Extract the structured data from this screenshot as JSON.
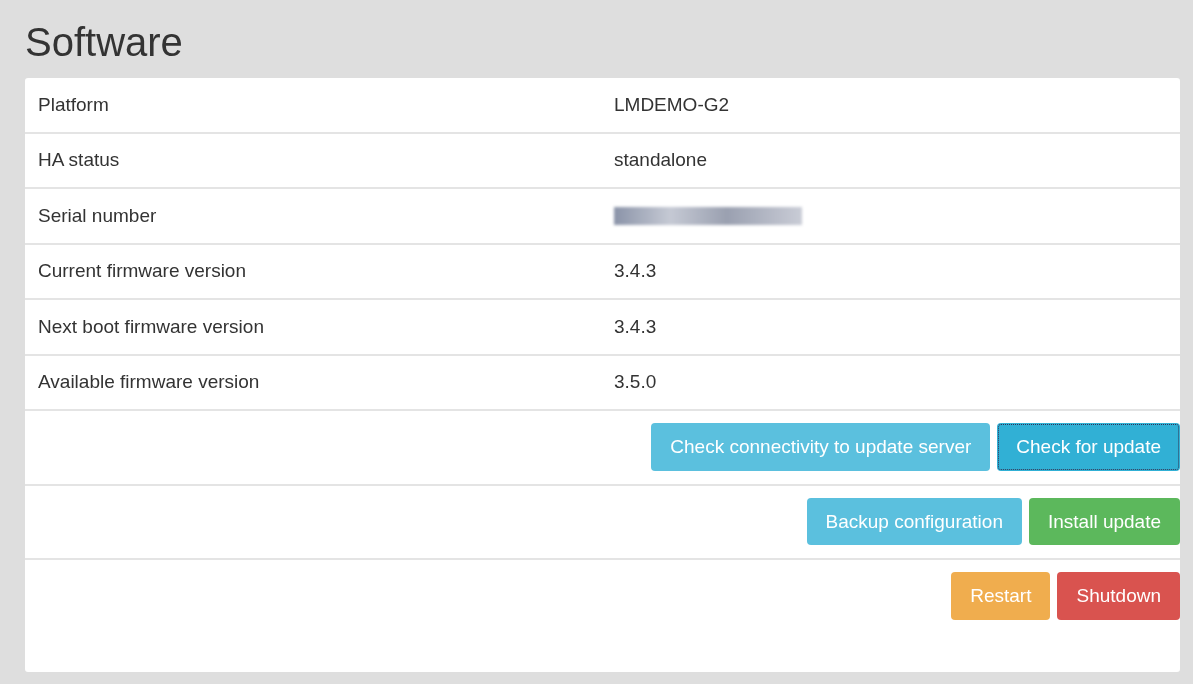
{
  "title": "Software",
  "rows": [
    {
      "label": "Platform",
      "value": "LMDEMO-G2"
    },
    {
      "label": "HA status",
      "value": "standalone"
    },
    {
      "label": "Serial number",
      "redacted": true
    },
    {
      "label": "Current firmware version",
      "value": "3.4.3"
    },
    {
      "label": "Next boot firmware version",
      "value": "3.4.3"
    },
    {
      "label": "Available firmware version",
      "value": "3.5.0"
    }
  ],
  "button_rows": [
    [
      {
        "label": "Check connectivity to update server",
        "kind": "info",
        "focused": false
      },
      {
        "label": "Check for update",
        "kind": "info",
        "focused": true
      }
    ],
    [
      {
        "label": "Backup configuration",
        "kind": "info",
        "focused": false
      },
      {
        "label": "Install update",
        "kind": "success",
        "focused": false
      }
    ],
    [
      {
        "label": "Restart",
        "kind": "warning",
        "focused": false
      },
      {
        "label": "Shutdown",
        "kind": "danger",
        "focused": false
      }
    ]
  ]
}
